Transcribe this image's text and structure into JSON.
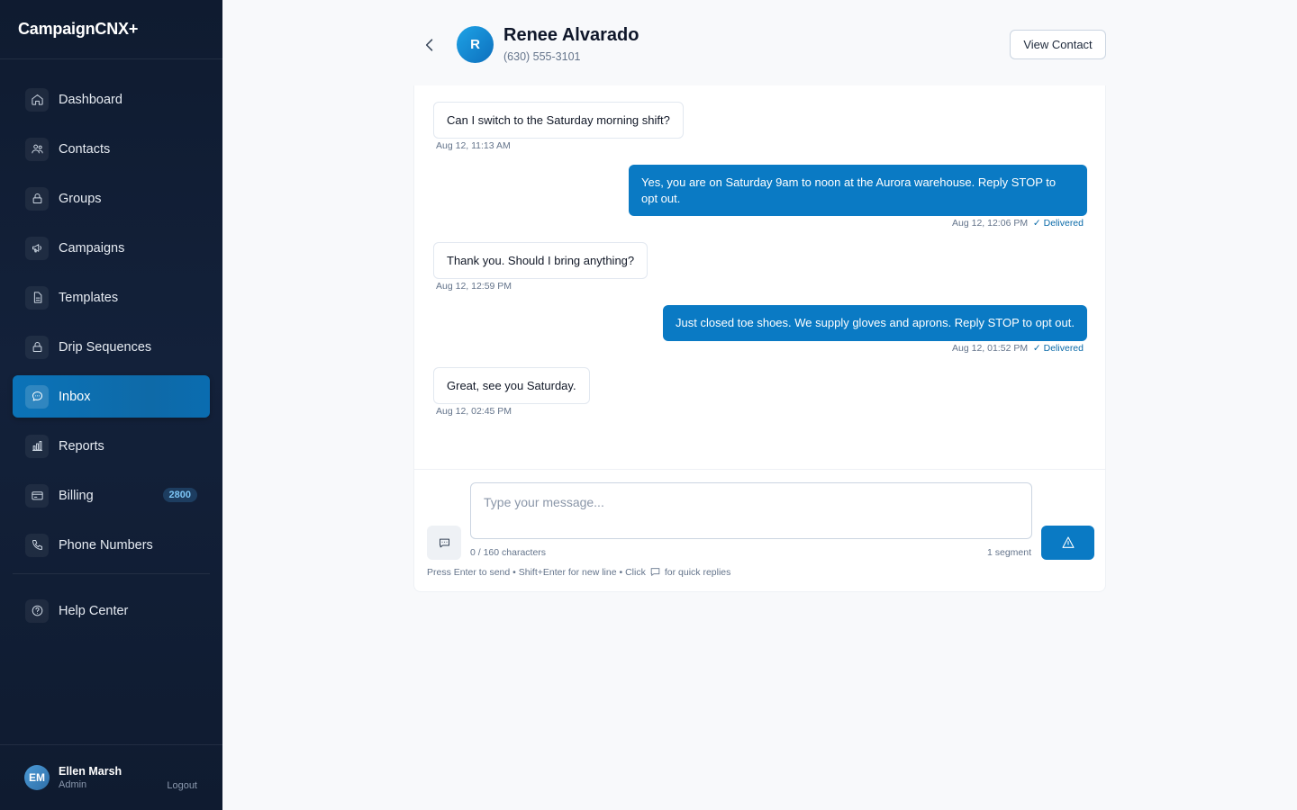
{
  "app": {
    "brand": "CampaignCNX+"
  },
  "sidebar": {
    "items": [
      {
        "label": "Dashboard",
        "icon": "home-icon"
      },
      {
        "label": "Contacts",
        "icon": "users-icon"
      },
      {
        "label": "Groups",
        "icon": "lock-icon"
      },
      {
        "label": "Campaigns",
        "icon": "megaphone-icon"
      },
      {
        "label": "Templates",
        "icon": "file-text-icon"
      },
      {
        "label": "Drip Sequences",
        "icon": "lock-icon"
      },
      {
        "label": "Inbox",
        "icon": "chat-bubble-icon",
        "active": true
      },
      {
        "label": "Reports",
        "icon": "bar-chart-icon"
      },
      {
        "label": "Billing",
        "icon": "credit-card-icon",
        "badge": "2800"
      },
      {
        "label": "Phone Numbers",
        "icon": "phone-icon"
      }
    ],
    "help": {
      "label": "Help Center",
      "icon": "help-circle-icon"
    },
    "user": {
      "initials": "EM",
      "name": "Ellen Marsh",
      "role": "Admin",
      "logout": "Logout"
    }
  },
  "conversation": {
    "contact": {
      "initial": "R",
      "name": "Renee Alvarado",
      "phone": "(630) 555-3101"
    },
    "view_contact_label": "View Contact",
    "messages": [
      {
        "direction": "inbound",
        "text": "Can I switch to the Saturday morning shift?",
        "time": "Aug 12, 11:13 AM"
      },
      {
        "direction": "outbound",
        "text": "Yes, you are on Saturday 9am to noon at the Aurora warehouse. Reply STOP to opt out.",
        "time": "Aug 12, 12:06 PM",
        "status": "✓ Delivered"
      },
      {
        "direction": "inbound",
        "text": "Thank you. Should I bring anything?",
        "time": "Aug 12, 12:59 PM"
      },
      {
        "direction": "outbound",
        "text": "Just closed toe shoes. We supply gloves and aprons. Reply STOP to opt out.",
        "time": "Aug 12, 01:52 PM",
        "status": "✓ Delivered"
      },
      {
        "direction": "inbound",
        "text": "Great, see you Saturday.",
        "time": "Aug 12, 02:45 PM"
      }
    ]
  },
  "composer": {
    "placeholder": "Type your message...",
    "value": "",
    "char_count": "0 / 160 characters",
    "segments": "1 segment",
    "hint_before": "Press Enter to send • Shift+Enter for new line • Click",
    "hint_after": "for quick replies",
    "send_icon": "send-icon",
    "quick_reply_icon": "quick-reply-icon"
  },
  "colors": {
    "accent": "#0a7ac4",
    "sidebar_bg": "#0f1b30",
    "badge_text": "#7cc4f4"
  }
}
